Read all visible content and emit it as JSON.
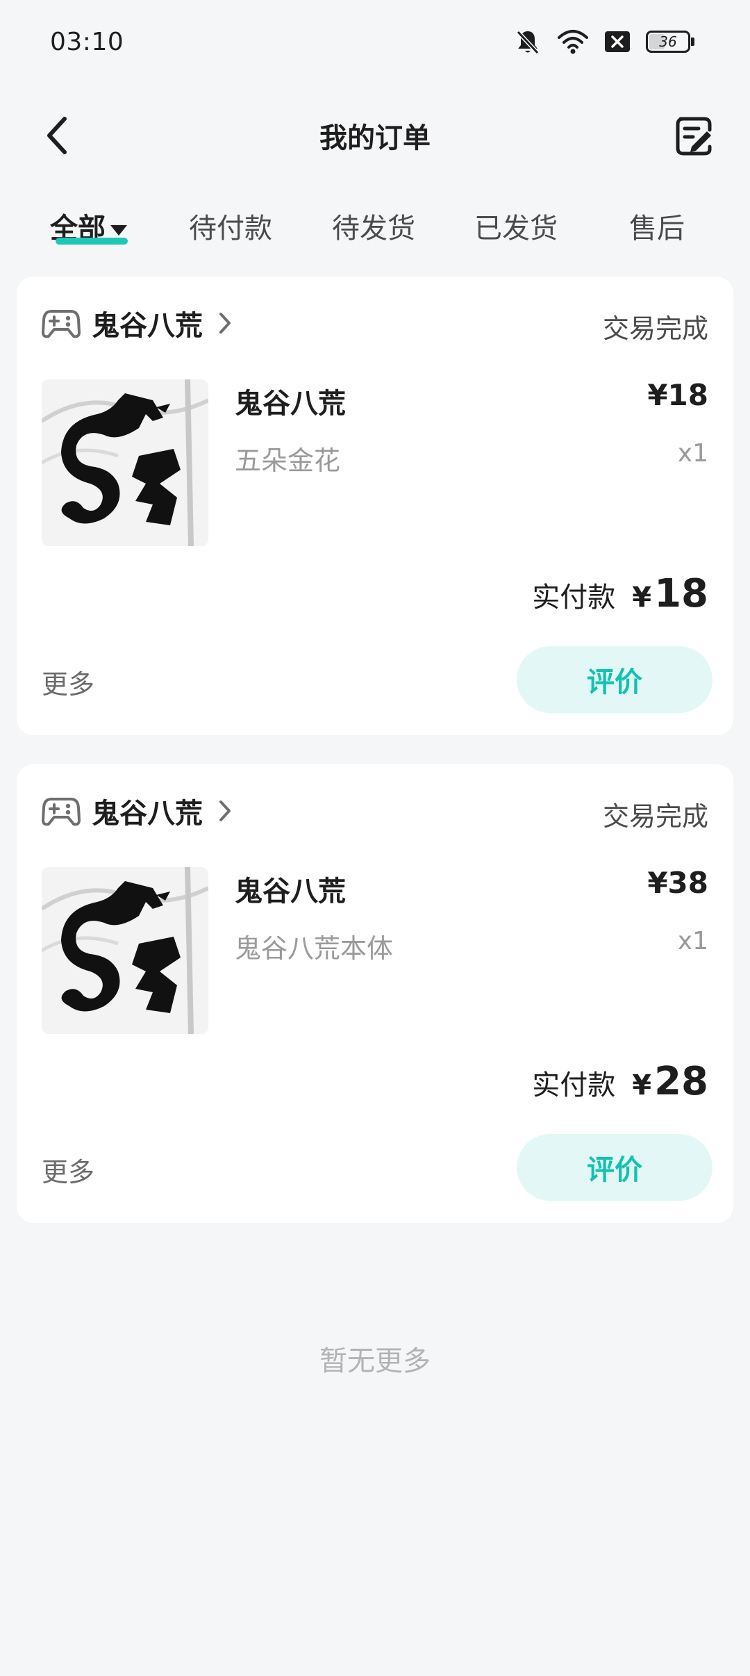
{
  "status_bar": {
    "time": "03:10",
    "icons": [
      "bell-muted-icon",
      "wifi-icon",
      "close-box-icon",
      "battery-icon"
    ],
    "battery_level": "36"
  },
  "header": {
    "title": "我的订单",
    "back_icon": "chevron-left-icon",
    "edit_icon": "note-edit-icon"
  },
  "tabs": [
    {
      "label": "全部",
      "active": true
    },
    {
      "label": "待付款",
      "active": false
    },
    {
      "label": "待发货",
      "active": false
    },
    {
      "label": "已发货",
      "active": false
    },
    {
      "label": "售后",
      "active": false
    }
  ],
  "accent_color": "#1FC7B6",
  "orders": [
    {
      "shop_name": "鬼谷八荒",
      "status": "交易完成",
      "item_name": "鬼谷八荒",
      "item_spec": "五朵金花",
      "price": "¥18",
      "quantity": "x1",
      "paid_label": "实付款",
      "paid_currency": "¥",
      "paid_amount": "18",
      "more_label": "更多",
      "review_label": "评价"
    },
    {
      "shop_name": "鬼谷八荒",
      "status": "交易完成",
      "item_name": "鬼谷八荒",
      "item_spec": "鬼谷八荒本体",
      "price": "¥38",
      "quantity": "x1",
      "paid_label": "实付款",
      "paid_currency": "¥",
      "paid_amount": "28",
      "more_label": "更多",
      "review_label": "评价"
    }
  ],
  "footer": {
    "no_more_text": "暂无更多"
  }
}
